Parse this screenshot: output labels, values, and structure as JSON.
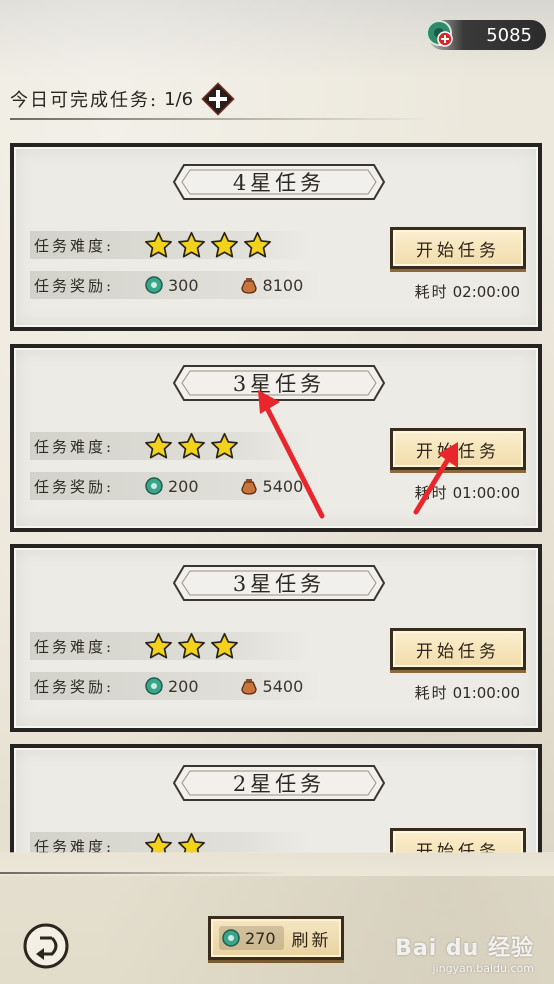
{
  "currency": {
    "value": "5085"
  },
  "daily": {
    "label": "今日可完成任务:",
    "count": "1/6"
  },
  "labels": {
    "difficulty": "任务难度:",
    "reward": "任务奖励:",
    "time": "耗时",
    "start": "开始任务"
  },
  "missions": [
    {
      "title": "4星任务",
      "stars": 4,
      "jade": "300",
      "coin": "8100",
      "time": "02:00:00"
    },
    {
      "title": "3星任务",
      "stars": 3,
      "jade": "200",
      "coin": "5400",
      "time": "01:00:00"
    },
    {
      "title": "3星任务",
      "stars": 3,
      "jade": "200",
      "coin": "5400",
      "time": "01:00:00"
    },
    {
      "title": "2星任务",
      "stars": 2
    }
  ],
  "refresh": {
    "cost": "270",
    "label": "刷新"
  },
  "watermark": {
    "brand": "Bai du 经验",
    "url": "jingyan.baidu.com"
  },
  "colors": {
    "star": "#f2d21a",
    "annotation_arrow": "#e8262b",
    "button": "#f1dcaa"
  }
}
